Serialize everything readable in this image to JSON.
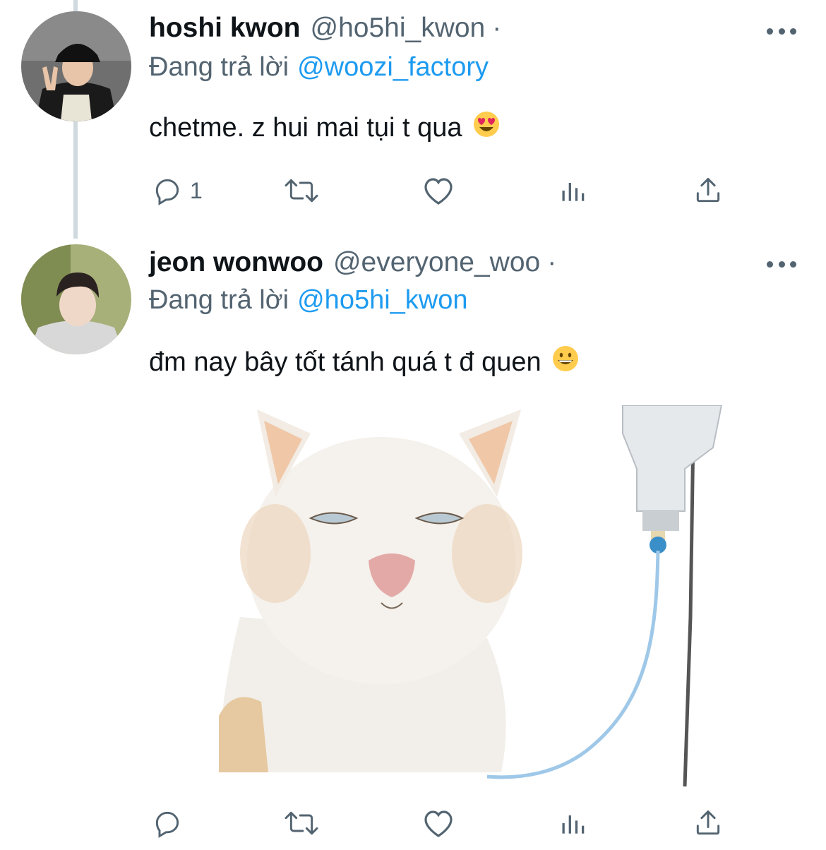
{
  "tweets": [
    {
      "display_name": "hoshi kwon",
      "handle": "@ho5hi_kwon",
      "separator": "·",
      "reply_prefix": "Đang trả lời",
      "reply_to": "@woozi_factory",
      "text": "chetme. z hui mai tụi t qua",
      "emoji": "heart-eyes-emoji",
      "reply_count": "1"
    },
    {
      "display_name": "jeon wonwoo",
      "handle": "@everyone_woo",
      "separator": "·",
      "reply_prefix": "Đang trả lời",
      "reply_to": "@ho5hi_kwon",
      "text": "đm nay bây tốt tánh quá t đ quen",
      "emoji": "grinning-emoji",
      "reply_count": ""
    }
  ],
  "icons": [
    "reply-icon",
    "retweet-icon",
    "like-icon",
    "views-icon",
    "share-icon",
    "more-icon"
  ],
  "colors": {
    "accent": "#1d9bf0",
    "secondary_text": "#536471",
    "thread_line": "#cfd9de"
  }
}
